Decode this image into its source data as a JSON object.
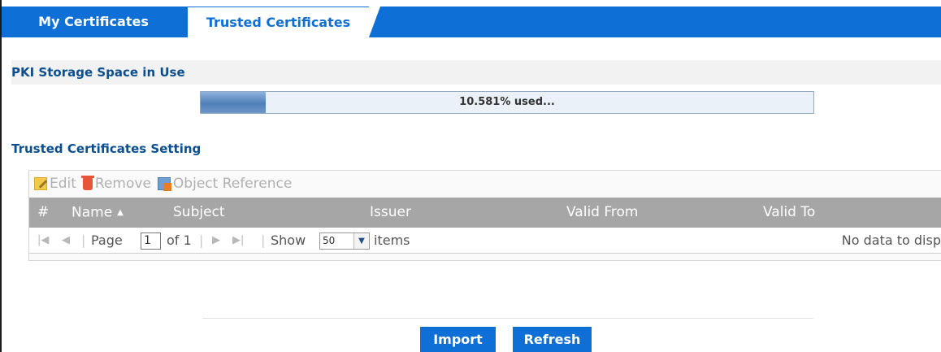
{
  "tabs": {
    "my_certificates": "My Certificates",
    "trusted_certificates": "Trusted Certificates"
  },
  "pki": {
    "heading": "PKI Storage Space in Use",
    "used_percent": 10.581,
    "used_text": "10.581% used..."
  },
  "trusted": {
    "heading": "Trusted Certificates Setting"
  },
  "toolbar": {
    "edit": "Edit",
    "remove": "Remove",
    "object_reference": "Object Reference"
  },
  "table": {
    "columns": [
      "#",
      "Name",
      "Subject",
      "Issuer",
      "Valid From",
      "Valid To"
    ],
    "sorted_column": "Name",
    "sort_direction": "ascending",
    "rows": []
  },
  "pager": {
    "page_label": "Page",
    "page_value": "1",
    "of_label": "of 1",
    "show_label": "Show",
    "items_per_page": "50",
    "items_label": "items",
    "no_data": "No data to disp"
  },
  "buttons": {
    "import": "Import",
    "refresh": "Refresh"
  },
  "colors": {
    "accent": "#0e6fd6",
    "header_gray": "#a6a6a6",
    "heading_text": "#0b4f8f"
  }
}
